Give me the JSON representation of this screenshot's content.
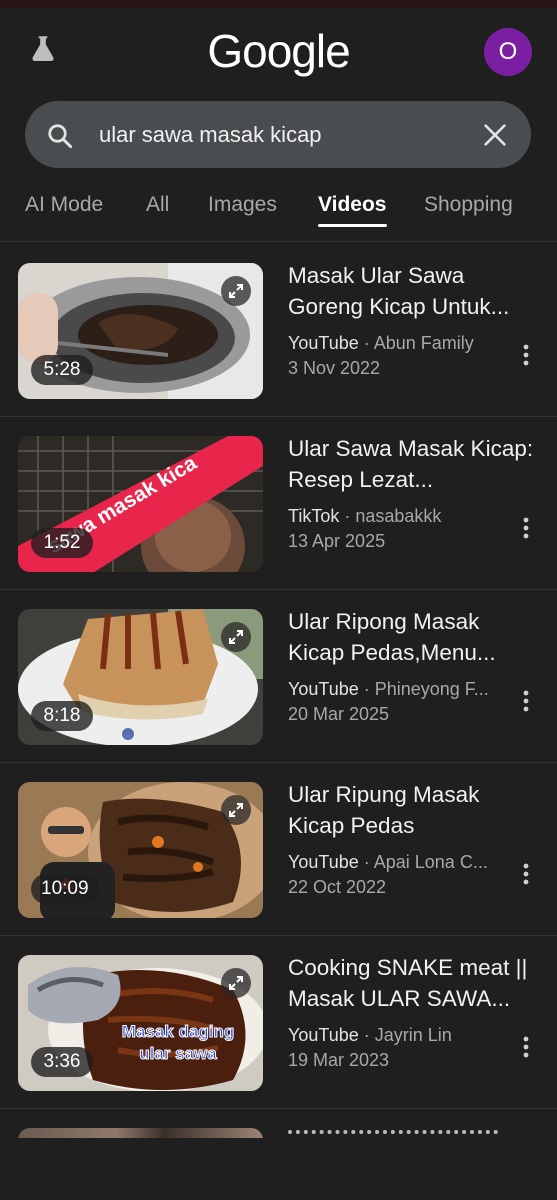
{
  "header": {
    "logo": "Google",
    "avatar_letter": "O"
  },
  "search": {
    "query": "ular sawa masak kicap"
  },
  "tabs": [
    {
      "label": "AI Mode"
    },
    {
      "label": "All"
    },
    {
      "label": "Images"
    },
    {
      "label": "Videos",
      "active": true
    },
    {
      "label": "Shopping"
    }
  ],
  "results": [
    {
      "title": "Masak Ular Sawa Goreng Kicap Untuk...",
      "source": "YouTube",
      "channel": "Abun Family",
      "date": "3 Nov 2022",
      "duration": "5:28"
    },
    {
      "title": "Ular Sawa Masak Kicap: Resep Lezat...",
      "source": "TikTok",
      "channel": "nasabakkk",
      "date": "13 Apr 2025",
      "duration": "1:52"
    },
    {
      "title": "Ular Ripong Masak Kicap Pedas,Menu...",
      "source": "YouTube",
      "channel": "Phineyong F...",
      "date": "20 Mar 2025",
      "duration": "8:18"
    },
    {
      "title": "Ular Ripung Masak Kicap Pedas",
      "source": "YouTube",
      "channel": "Apai Lona C...",
      "date": "22 Oct 2022",
      "duration": "10:09"
    },
    {
      "title": "Cooking SNAKE meat || Masak ULAR SAWA...",
      "source": "YouTube",
      "channel": "Jayrin Lin",
      "date": "19 Mar 2023",
      "duration": "3:36"
    }
  ],
  "thumb_texts": {
    "r2_overlay": "sawa masak kica",
    "r5_overlay_1": "Masak daging",
    "r5_overlay_2": "ular sawa"
  },
  "colors": {
    "background": "#1f1f1f",
    "search_bg": "#4a4d50",
    "avatar": "#7b1fa2",
    "overlay_red": "#e8254a"
  }
}
